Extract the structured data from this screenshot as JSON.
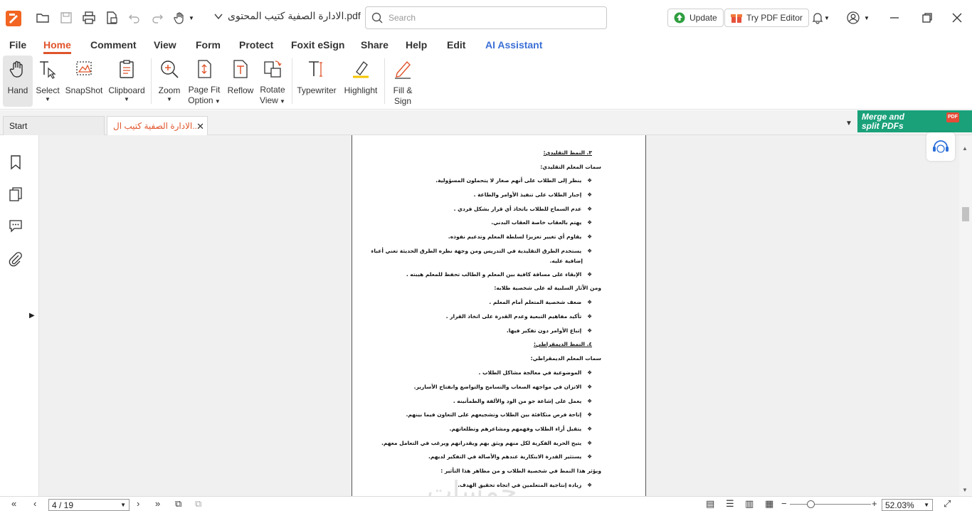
{
  "titlebar": {
    "doc_title": "الادارة الصفية كتيب المحتوى.pdf",
    "search_placeholder": "Search",
    "update_label": "Update",
    "try_editor_label": "Try PDF Editor"
  },
  "menu": {
    "file": "File",
    "home": "Home",
    "comment": "Comment",
    "view": "View",
    "form": "Form",
    "protect": "Protect",
    "esign": "Foxit eSign",
    "share": "Share",
    "help": "Help",
    "edit": "Edit",
    "ai": "AI Assistant"
  },
  "ribbon": {
    "hand": "Hand",
    "select": "Select",
    "snapshot": "SnapShot",
    "clipboard": "Clipboard",
    "zoom": "Zoom",
    "page_fit_1": "Page Fit",
    "page_fit_2": "Option",
    "reflow": "Reflow",
    "rotate_1": "Rotate",
    "rotate_2": "View",
    "typewriter": "Typewriter",
    "highlight": "Highlight",
    "fill_sign_1": "Fill &",
    "fill_sign_2": "Sign"
  },
  "tabs": {
    "start": "Start",
    "doc": "الادارة الصفية كتيب ال..."
  },
  "banner": {
    "line1": "Merge and",
    "line2": "split PDFs",
    "badge": "PDF"
  },
  "document": {
    "lines": [
      {
        "type": "sec",
        "text": "٣.  النمط التقليدي:"
      },
      {
        "type": "head",
        "text": "سمات المعلم التقليدي:"
      },
      {
        "type": "bul",
        "text": "ينظر إلى الطلاب على أنهم صغار لا يتحملون المسؤولية."
      },
      {
        "type": "bul",
        "text": "إجبار الطلاب على تنفيذ الأوامر والطاعة ."
      },
      {
        "type": "bul",
        "text": "عدم السماح للطلاب باتخاذ أي قرار بشكل فردي ."
      },
      {
        "type": "bul",
        "text": "يهتم بالعقاب خاصة العقاب البدني."
      },
      {
        "type": "bul",
        "text": "يقاوم أي تغيير تعزيزا لسلطة المعلم وتدعيم نفوذه."
      },
      {
        "type": "bul",
        "text": "يستخدم الطرق التقليدية في التدريس ومن وجهة نظره الطرق الحديثة تعني أعباء"
      },
      {
        "type": "cont",
        "text": "إضافية عليه."
      },
      {
        "type": "bul",
        "text": "الإبقاء على مسافة كافية بين المعلم و الطالب تحفظ للمعلم هيبته ."
      },
      {
        "type": "head",
        "text": "ومن الآثار السلبية له على شخصية طلابه:"
      },
      {
        "type": "bul",
        "text": "ضعف شخصية المتعلم أمام المعلم ."
      },
      {
        "type": "bul",
        "text": "تأكيد مفاهيم التبعية وعدم القدرة على اتخاذ القرار ."
      },
      {
        "type": "bul",
        "text": "إتباع الأوامر دون تفكير فيها."
      },
      {
        "type": "sec",
        "text": "٤.  النمط الديمقراطي:"
      },
      {
        "type": "head",
        "text": "سمات المعلم الديمقراطي:"
      },
      {
        "type": "bul",
        "text": "الموضوعية في معالجة مشاكل الطلاب ."
      },
      {
        "type": "bul",
        "text": "الاتزان في مواجهه الصعاب والتسامح والتواضع وانفتاح الأسارير."
      },
      {
        "type": "bul",
        "text": "يعمل على إشاعة جو من الود والألفة والطمأنينه ."
      },
      {
        "type": "bul",
        "text": "إتاحة فرص متكافئة بين الطلاب وتشجيعهم على التعاون فيما بينهم."
      },
      {
        "type": "bul",
        "text": "يتقبل أراء الطلاب  وفهمهم ومشاعرهم وتطلعاتهم."
      },
      {
        "type": "bul",
        "text": "يتيح الحرية الفكرية لكل منهم ويثق بهم ويقدرانهم ويرغب في التعامل معهم."
      },
      {
        "type": "bul",
        "text": "يستثير القدرة الابتكارية عندهم والأصالة في التفكير لديهم."
      },
      {
        "type": "head",
        "text": "ويؤثر هذا النمط في شخصية الطلاب و من مظاهر هذا التأثير :"
      },
      {
        "type": "bul",
        "text": "زيادة إنتاجية المتعلمين في اتجاه تحقيق الهدف."
      }
    ]
  },
  "watermark": "خمسات",
  "status": {
    "page": "4 / 19",
    "zoom": "52.03%"
  }
}
